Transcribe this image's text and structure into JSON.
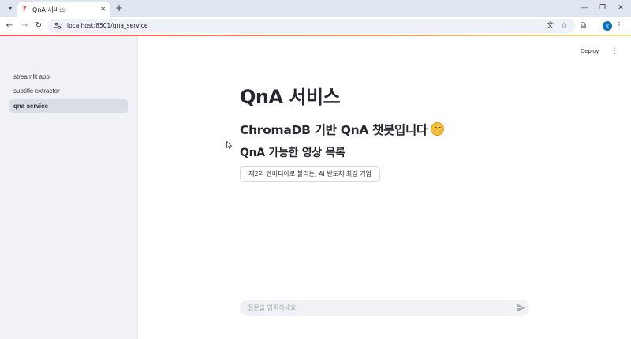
{
  "browser": {
    "tab": {
      "favicon": "?",
      "title": "QnA 서비스"
    },
    "url": "localhost:8501/qna_service",
    "profile_initial": "k"
  },
  "app": {
    "deploy_label": "Deploy"
  },
  "sidebar": {
    "items": [
      {
        "label": "streamlit app",
        "active": false
      },
      {
        "label": "subtitle extractor",
        "active": false
      },
      {
        "label": "qna service",
        "active": true
      }
    ]
  },
  "main": {
    "title": "QnA 서비스",
    "subtitle": "ChromaDB 기반 QnA 챗봇입니다",
    "list_heading": "QnA 가능한 영상 목록",
    "videos": [
      "제2의 엔비디아로 불리는, AI 반도체 최강 기업"
    ],
    "chat_placeholder": "질문을 입력하세요."
  },
  "colors": {
    "accent": "#ff4b4b",
    "sidebar_bg": "#f0f2f6",
    "profile": "#0b6fb6"
  }
}
